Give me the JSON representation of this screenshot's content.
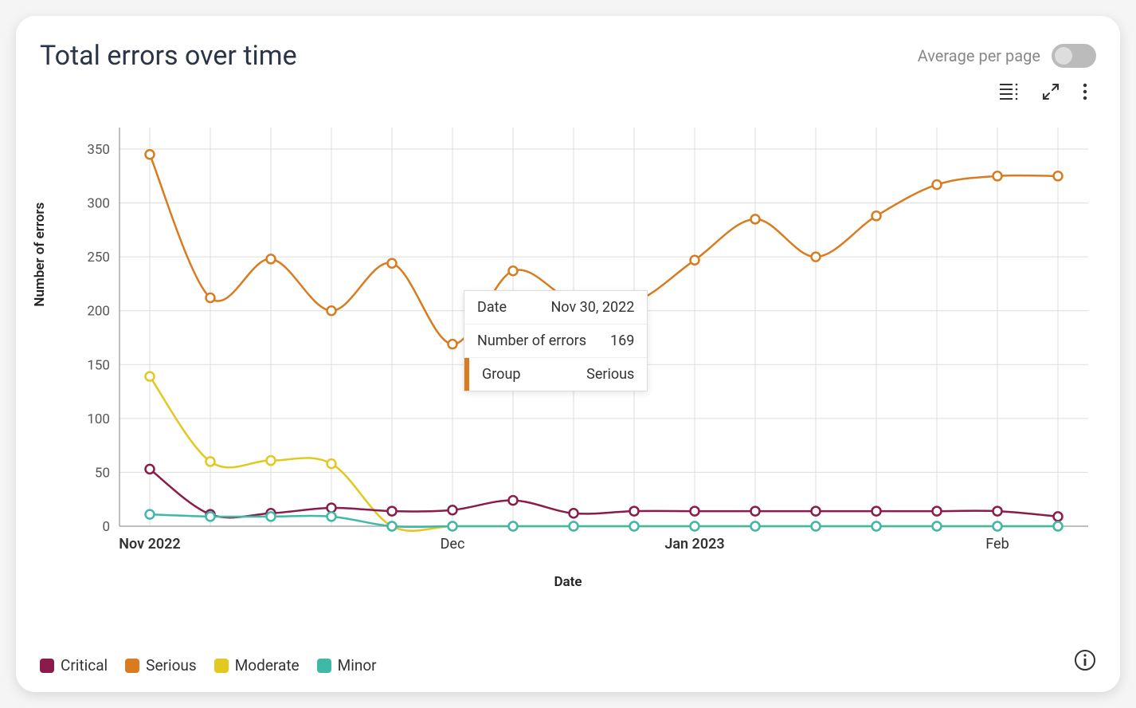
{
  "title": "Total errors over time",
  "avg_label": "Average per page",
  "toolbar": {
    "table_view": "table-view",
    "expand": "expand",
    "menu": "more-options"
  },
  "ylabel": "Number of errors",
  "xlabel": "Date",
  "legend": [
    {
      "name": "Critical",
      "color": "#8a1b4b"
    },
    {
      "name": "Serious",
      "color": "#d97b1f"
    },
    {
      "name": "Moderate",
      "color": "#e3c81f"
    },
    {
      "name": "Minor",
      "color": "#3fb8a8"
    }
  ],
  "tooltip": {
    "date_label": "Date",
    "date_value": "Nov 30, 2022",
    "errors_label": "Number of errors",
    "errors_value": "169",
    "group_label": "Group",
    "group_value": "Serious",
    "group_color": "#d97b1f"
  },
  "chart_data": {
    "type": "line",
    "xlabel": "Date",
    "ylabel": "Number of errors",
    "ylim": [
      0,
      370
    ],
    "y_ticks": [
      0,
      50,
      100,
      150,
      200,
      250,
      300,
      350
    ],
    "x_labels": [
      {
        "index": 0,
        "label": "Nov 2022",
        "major": true
      },
      {
        "index": 5,
        "label": "Dec",
        "major": false
      },
      {
        "index": 9,
        "label": "Jan 2023",
        "major": true
      },
      {
        "index": 14,
        "label": "Feb",
        "major": false
      }
    ],
    "categories": [
      "2022-10-26",
      "2022-11-02",
      "2022-11-09",
      "2022-11-16",
      "2022-11-23",
      "2022-11-30",
      "2022-12-07",
      "2022-12-14",
      "2022-12-21",
      "2022-12-28",
      "2023-01-04",
      "2023-01-11",
      "2023-01-18",
      "2023-01-25",
      "2023-02-01",
      "2023-02-08"
    ],
    "series": [
      {
        "name": "Serious",
        "color": "#d97b1f",
        "values": [
          345,
          212,
          248,
          200,
          244,
          169,
          237,
          209,
          208,
          247,
          285,
          250,
          288,
          317,
          325,
          325
        ]
      },
      {
        "name": "Moderate",
        "color": "#e3c81f",
        "values": [
          139,
          60,
          61,
          58,
          0,
          0,
          0,
          0,
          0,
          0,
          0,
          0,
          0,
          0,
          0,
          0
        ]
      },
      {
        "name": "Critical",
        "color": "#8a1b4b",
        "values": [
          53,
          11,
          12,
          17,
          14,
          15,
          24,
          12,
          14,
          14,
          14,
          14,
          14,
          14,
          14,
          9
        ]
      },
      {
        "name": "Minor",
        "color": "#3fb8a8",
        "values": [
          11,
          9,
          9,
          9,
          0,
          0,
          0,
          0,
          0,
          0,
          0,
          0,
          0,
          0,
          0,
          0
        ]
      }
    ],
    "highlight": {
      "series": "Serious",
      "index": 5
    }
  }
}
